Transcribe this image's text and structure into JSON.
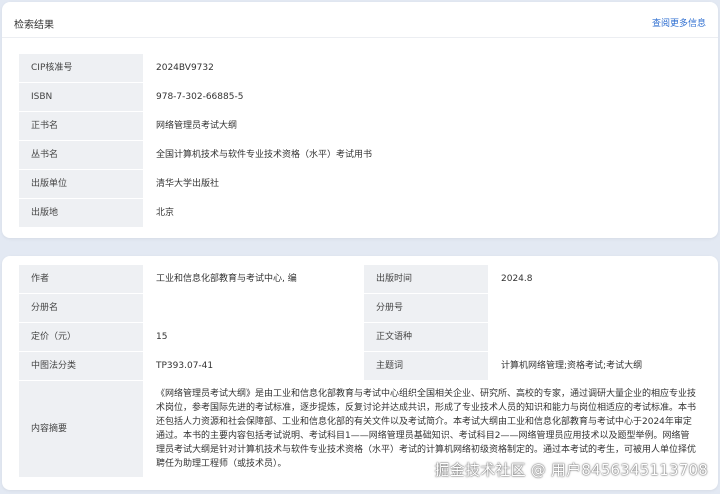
{
  "card1": {
    "title": "检索结果",
    "more_link": "查阅更多信息",
    "rows": [
      {
        "label": "CIP核准号",
        "value": "2024BV9732"
      },
      {
        "label": "ISBN",
        "value": "978-7-302-66885-5"
      },
      {
        "label": "正书名",
        "value": "网络管理员考试大纲"
      },
      {
        "label": "丛书名",
        "value": "全国计算机技术与软件专业技术资格（水平）考试用书"
      },
      {
        "label": "出版单位",
        "value": "清华大学出版社"
      },
      {
        "label": "出版地",
        "value": "北京"
      }
    ]
  },
  "card2": {
    "rows": [
      {
        "label1": "作者",
        "value1": "工业和信息化部教育与考试中心, 编",
        "label2": "出版时间",
        "value2": "2024.8"
      },
      {
        "label1": "分册名",
        "value1": "",
        "label2": "分册号",
        "value2": ""
      },
      {
        "label1": "定价（元）",
        "value1": "15",
        "label2": "正文语种",
        "value2": ""
      },
      {
        "label1": "中图法分类",
        "value1": "TP393.07-41",
        "label2": "主题词",
        "value2": "计算机网络管理;资格考试;考试大纲"
      }
    ],
    "summary_label": "内容摘要",
    "summary": "《网络管理员考试大纲》是由工业和信息化部教育与考试中心组织全国相关企业、研究所、高校的专家，通过调研大量企业的相应专业技术岗位，参考国际先进的考试标准，逐步提炼，反复讨论并达成共识，形成了专业技术人员的知识和能力与岗位相适应的考试标准。本书还包括人力资源和社会保障部、工业和信息化部的有关文件以及考试简介。本考试大纲由工业和信息化部教育与考试中心于2024年审定通过。本书的主要内容包括考试说明、考试科目1——网络管理员基础知识、考试科目2——网络管理员应用技术以及题型举例。网络管理员考试大纲是针对计算机技术与软件专业技术资格（水平）考试的计算机网络初级资格制定的。通过本考试的考生，可被用人单位择优聘任为助理工程师（或技术员）。"
  },
  "watermark": "掘金技术社区 @ 用户8456345113708"
}
